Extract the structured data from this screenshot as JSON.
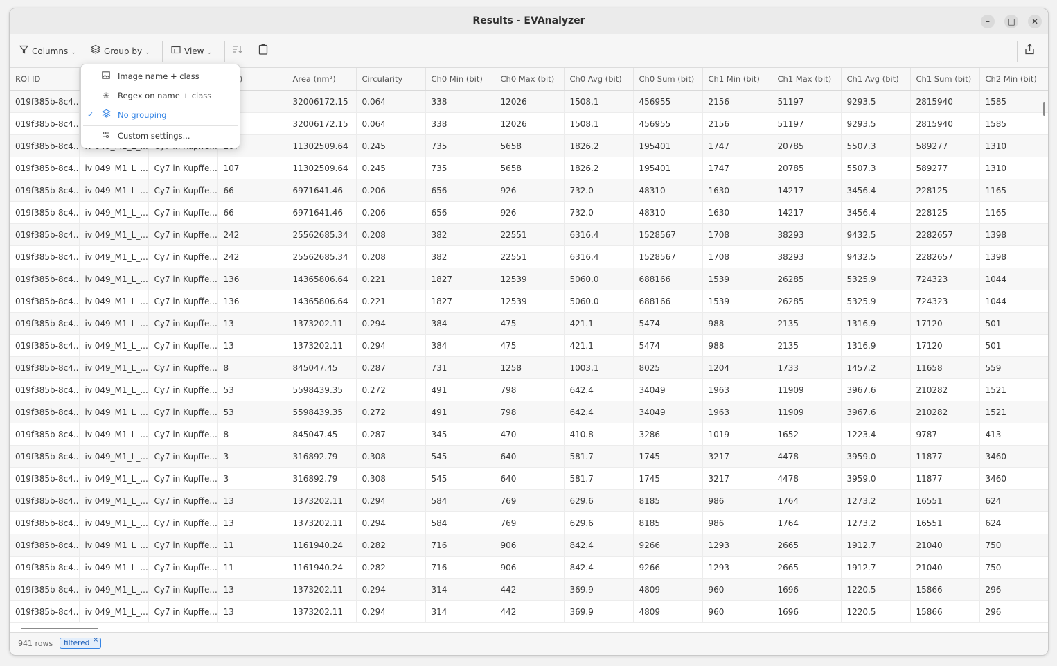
{
  "window": {
    "title": "Results - EVAnalyzer",
    "minimize": "–",
    "maximize": "□",
    "close": "✕"
  },
  "toolbar": {
    "columns": "Columns",
    "group_by": "Group by",
    "view": "View"
  },
  "group_menu": {
    "items": [
      {
        "label": "Image name + class",
        "icon": "image-icon",
        "selected": false
      },
      {
        "label": "Regex on name + class",
        "icon": "asterisk-icon",
        "selected": false
      },
      {
        "label": "No grouping",
        "icon": "layers-icon",
        "selected": true
      },
      {
        "label": "Custom settings...",
        "icon": "sliders-icon",
        "selected": false
      }
    ]
  },
  "table": {
    "headers": [
      "ROI ID",
      "",
      "",
      "(px²)",
      "Area (nm²)",
      "Circularity",
      "Ch0 Min (bit)",
      "Ch0 Max (bit)",
      "Ch0 Avg (bit)",
      "Ch0 Sum (bit)",
      "Ch1 Min (bit)",
      "Ch1 Max (bit)",
      "Ch1 Avg (bit)",
      "Ch1 Sum (bit)",
      "Ch2 Min (bit)"
    ],
    "rows": [
      [
        "019f385b-8c4...",
        "",
        "",
        "",
        "32006172.15",
        "0.064",
        "338",
        "12026",
        "1508.1",
        "456955",
        "2156",
        "51197",
        "9293.5",
        "2815940",
        "1585"
      ],
      [
        "019f385b-8c4...",
        "",
        "",
        "",
        "32006172.15",
        "0.064",
        "338",
        "12026",
        "1508.1",
        "456955",
        "2156",
        "51197",
        "9293.5",
        "2815940",
        "1585"
      ],
      [
        "019f385b-8c4...",
        "iv 049_M1_L_...",
        "Cy7 in Kupffe...",
        "107",
        "11302509.64",
        "0.245",
        "735",
        "5658",
        "1826.2",
        "195401",
        "1747",
        "20785",
        "5507.3",
        "589277",
        "1310"
      ],
      [
        "019f385b-8c4...",
        "iv 049_M1_L_...",
        "Cy7 in Kupffe...",
        "107",
        "11302509.64",
        "0.245",
        "735",
        "5658",
        "1826.2",
        "195401",
        "1747",
        "20785",
        "5507.3",
        "589277",
        "1310"
      ],
      [
        "019f385b-8c4...",
        "iv 049_M1_L_...",
        "Cy7 in Kupffe...",
        "66",
        "6971641.46",
        "0.206",
        "656",
        "926",
        "732.0",
        "48310",
        "1630",
        "14217",
        "3456.4",
        "228125",
        "1165"
      ],
      [
        "019f385b-8c4...",
        "iv 049_M1_L_...",
        "Cy7 in Kupffe...",
        "66",
        "6971641.46",
        "0.206",
        "656",
        "926",
        "732.0",
        "48310",
        "1630",
        "14217",
        "3456.4",
        "228125",
        "1165"
      ],
      [
        "019f385b-8c4...",
        "iv 049_M1_L_...",
        "Cy7 in Kupffe...",
        "242",
        "25562685.34",
        "0.208",
        "382",
        "22551",
        "6316.4",
        "1528567",
        "1708",
        "38293",
        "9432.5",
        "2282657",
        "1398"
      ],
      [
        "019f385b-8c4...",
        "iv 049_M1_L_...",
        "Cy7 in Kupffe...",
        "242",
        "25562685.34",
        "0.208",
        "382",
        "22551",
        "6316.4",
        "1528567",
        "1708",
        "38293",
        "9432.5",
        "2282657",
        "1398"
      ],
      [
        "019f385b-8c4...",
        "iv 049_M1_L_...",
        "Cy7 in Kupffe...",
        "136",
        "14365806.64",
        "0.221",
        "1827",
        "12539",
        "5060.0",
        "688166",
        "1539",
        "26285",
        "5325.9",
        "724323",
        "1044"
      ],
      [
        "019f385b-8c4...",
        "iv 049_M1_L_...",
        "Cy7 in Kupffe...",
        "136",
        "14365806.64",
        "0.221",
        "1827",
        "12539",
        "5060.0",
        "688166",
        "1539",
        "26285",
        "5325.9",
        "724323",
        "1044"
      ],
      [
        "019f385b-8c4...",
        "iv 049_M1_L_...",
        "Cy7 in Kupffe...",
        "13",
        "1373202.11",
        "0.294",
        "384",
        "475",
        "421.1",
        "5474",
        "988",
        "2135",
        "1316.9",
        "17120",
        "501"
      ],
      [
        "019f385b-8c4...",
        "iv 049_M1_L_...",
        "Cy7 in Kupffe...",
        "13",
        "1373202.11",
        "0.294",
        "384",
        "475",
        "421.1",
        "5474",
        "988",
        "2135",
        "1316.9",
        "17120",
        "501"
      ],
      [
        "019f385b-8c4...",
        "iv 049_M1_L_...",
        "Cy7 in Kupffe...",
        "8",
        "845047.45",
        "0.287",
        "731",
        "1258",
        "1003.1",
        "8025",
        "1204",
        "1733",
        "1457.2",
        "11658",
        "559"
      ],
      [
        "019f385b-8c4...",
        "iv 049_M1_L_...",
        "Cy7 in Kupffe...",
        "53",
        "5598439.35",
        "0.272",
        "491",
        "798",
        "642.4",
        "34049",
        "1963",
        "11909",
        "3967.6",
        "210282",
        "1521"
      ],
      [
        "019f385b-8c4...",
        "iv 049_M1_L_...",
        "Cy7 in Kupffe...",
        "53",
        "5598439.35",
        "0.272",
        "491",
        "798",
        "642.4",
        "34049",
        "1963",
        "11909",
        "3967.6",
        "210282",
        "1521"
      ],
      [
        "019f385b-8c4...",
        "iv 049_M1_L_...",
        "Cy7 in Kupffe...",
        "8",
        "845047.45",
        "0.287",
        "345",
        "470",
        "410.8",
        "3286",
        "1019",
        "1652",
        "1223.4",
        "9787",
        "413"
      ],
      [
        "019f385b-8c4...",
        "iv 049_M1_L_...",
        "Cy7 in Kupffe...",
        "3",
        "316892.79",
        "0.308",
        "545",
        "640",
        "581.7",
        "1745",
        "3217",
        "4478",
        "3959.0",
        "11877",
        "3460"
      ],
      [
        "019f385b-8c4...",
        "iv 049_M1_L_...",
        "Cy7 in Kupffe...",
        "3",
        "316892.79",
        "0.308",
        "545",
        "640",
        "581.7",
        "1745",
        "3217",
        "4478",
        "3959.0",
        "11877",
        "3460"
      ],
      [
        "019f385b-8c4...",
        "iv 049_M1_L_...",
        "Cy7 in Kupffe...",
        "13",
        "1373202.11",
        "0.294",
        "584",
        "769",
        "629.6",
        "8185",
        "986",
        "1764",
        "1273.2",
        "16551",
        "624"
      ],
      [
        "019f385b-8c4...",
        "iv 049_M1_L_...",
        "Cy7 in Kupffe...",
        "13",
        "1373202.11",
        "0.294",
        "584",
        "769",
        "629.6",
        "8185",
        "986",
        "1764",
        "1273.2",
        "16551",
        "624"
      ],
      [
        "019f385b-8c4...",
        "iv 049_M1_L_...",
        "Cy7 in Kupffe...",
        "11",
        "1161940.24",
        "0.282",
        "716",
        "906",
        "842.4",
        "9266",
        "1293",
        "2665",
        "1912.7",
        "21040",
        "750"
      ],
      [
        "019f385b-8c4...",
        "iv 049_M1_L_...",
        "Cy7 in Kupffe...",
        "11",
        "1161940.24",
        "0.282",
        "716",
        "906",
        "842.4",
        "9266",
        "1293",
        "2665",
        "1912.7",
        "21040",
        "750"
      ],
      [
        "019f385b-8c4...",
        "iv 049_M1_L_...",
        "Cy7 in Kupffe...",
        "13",
        "1373202.11",
        "0.294",
        "314",
        "442",
        "369.9",
        "4809",
        "960",
        "1696",
        "1220.5",
        "15866",
        "296"
      ],
      [
        "019f385b-8c4...",
        "iv 049_M1_L_...",
        "Cy7 in Kupffe...",
        "13",
        "1373202.11",
        "0.294",
        "314",
        "442",
        "369.9",
        "4809",
        "960",
        "1696",
        "1220.5",
        "15866",
        "296"
      ]
    ]
  },
  "status": {
    "rows": "941 rows",
    "filter_chip": "filtered",
    "filter_chip_close": "×"
  },
  "colors": {
    "accent": "#3584e4",
    "alt_row": "#f7f7f7"
  }
}
